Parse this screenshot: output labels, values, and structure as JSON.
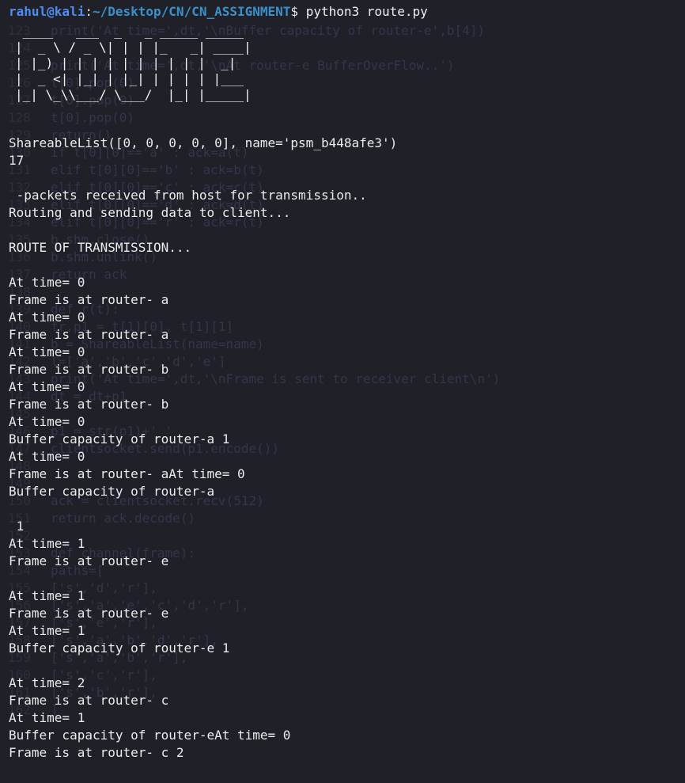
{
  "prompt": {
    "user_host": "rahul@kali",
    "separator": ":",
    "path": "~/Desktop/CN/CN_ASSIGNMENT",
    "symbol": "$ ",
    "command": "python3 route.py"
  },
  "banner": {
    "art": " ____   ___  _   _ _____ _____\n|  _ \\ / _ \\| | | |_   _| ____|\n| |_) | | | | | | | | | |  _|\n|  _ <| |_| | |_| | | | | |___\n|_| \\_\\\\___/ \\___/  |_| |_____|",
    "label": "ROUTE"
  },
  "output_lines": [
    "ShareableList([0, 0, 0, 0, 0], name='psm_b448afe3')",
    "17",
    "",
    " -packets received from host for transmission..",
    "Routing and sending data to client...",
    "",
    "ROUTE OF TRANSMISSION...",
    "",
    "At time= 0",
    "Frame is at router- a",
    "At time= 0",
    "Frame is at router- a",
    "At time= 0",
    "Frame is at router- b",
    "At time= 0",
    "Frame is at router- b",
    "At time= 0",
    "Buffer capacity of router-a 1",
    "At time= 0",
    "Frame is at router- aAt time= 0",
    "Buffer capacity of router-a",
    "",
    " 1",
    "At time= 1",
    "Frame is at router- e",
    "",
    "At time= 1",
    "Frame is at router- e",
    "At time= 1",
    "Buffer capacity of router-e 1",
    "",
    "At time= 2",
    "Frame is at router- c",
    "At time= 1",
    "Buffer capacity of router-eAt time= 0",
    "Frame is at router- c 2"
  ],
  "ghost_code": [
    {
      "num": "123",
      "code": "print('At time=',dt,'\\nBuffer capacity of router-e',b[4])"
    },
    {
      "num": "124",
      "code": ""
    },
    {
      "num": "125",
      "code": "print('At time=',dt,'\\nAt router-e BufferOverFlow..')"
    },
    {
      "num": "126",
      "code": "t[0].pop(0)"
    },
    {
      "num": "127",
      "code": "t[0].pop(0)"
    },
    {
      "num": "128",
      "code": "t[0].pop(0)"
    },
    {
      "num": "129",
      "code": "return()"
    },
    {
      "num": "130",
      "code": "if t[0][0]=='a' : ack=a(t)"
    },
    {
      "num": "131",
      "code": "elif t[0][0]=='b' : ack=b(t)"
    },
    {
      "num": "132",
      "code": "elif t[0][0]=='c' : ack=c(t)"
    },
    {
      "num": "133",
      "code": "elif t[0][0]=='d' : ack=d(t)"
    },
    {
      "num": "134",
      "code": "elif t[0][0]=='r' : ack=r(t)"
    },
    {
      "num": "135",
      "code": "b.shm.close()"
    },
    {
      "num": "136",
      "code": "b.shm.unlink()"
    },
    {
      "num": "137",
      "code": "return ack"
    },
    {
      "num": "138",
      "code": ""
    },
    {
      "num": "139",
      "code": "def r(t):"
    },
    {
      "num": "140",
      "code": "fr,p1 = t[1][0], t[1][1]"
    },
    {
      "num": "141",
      "code": "b = ShareableList(name=name)"
    },
    {
      "num": "142",
      "code": "l=['a','b','c','d','e']"
    },
    {
      "num": "143",
      "code": "print('At time=',dt,'\\nFrame is sent to receiver client\\n')"
    },
    {
      "num": "144",
      "code": "dt = dt+p1"
    },
    {
      "num": "145",
      "code": ""
    },
    {
      "num": "146",
      "code": "p1 = str(p1)+' '"
    },
    {
      "num": "147",
      "code": "clientsocket.send(p1.encode())"
    },
    {
      "num": "148",
      "code": ""
    },
    {
      "num": "149",
      "code": ""
    },
    {
      "num": "150",
      "code": "ack = clientsocket.recv(512)"
    },
    {
      "num": "151",
      "code": "return ack.decode()"
    },
    {
      "num": "152",
      "code": ""
    },
    {
      "num": "153",
      "code": "def channel(frame):"
    },
    {
      "num": "154",
      "code": "paths=["
    },
    {
      "num": "155",
      "code": "['s','d','r'],"
    },
    {
      "num": "156",
      "code": "['s','a','e','c','d','r'],"
    },
    {
      "num": "157",
      "code": "['s','e','r'],"
    },
    {
      "num": "158",
      "code": "['s','a','b','d','r'],"
    },
    {
      "num": "159",
      "code": "['s','a','b','r'],"
    },
    {
      "num": "160",
      "code": "['s','c','r'],"
    },
    {
      "num": "161",
      "code": "['s','b','r'],"
    },
    {
      "num": "162",
      "code": "]"
    }
  ],
  "colors": {
    "background": "#1f2028",
    "text": "#ececec",
    "user_host": "#4e8df2",
    "path": "#3a91c9"
  }
}
